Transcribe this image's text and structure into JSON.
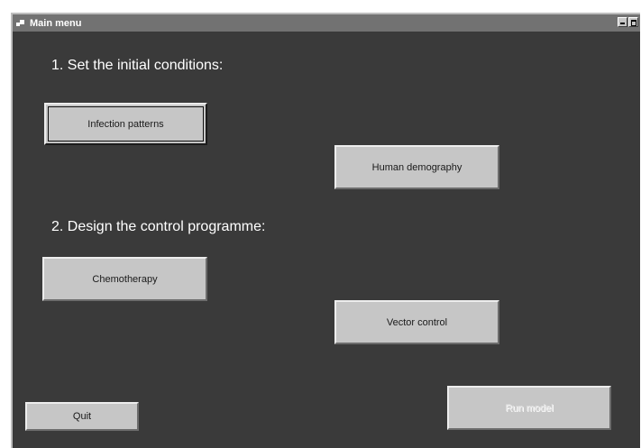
{
  "window": {
    "title": "Main menu"
  },
  "section1": {
    "heading": "1. Set the initial conditions:"
  },
  "section2": {
    "heading": "2. Design the control programme:"
  },
  "buttons": {
    "infection_patterns": "Infection patterns",
    "human_demography": "Human demography",
    "chemotherapy": "Chemotherapy",
    "vector_control": "Vector control",
    "quit": "Quit",
    "run_model": "Run model"
  },
  "colors": {
    "window_bg": "#3a3a3a",
    "titlebar": "#727272",
    "button_face": "#c6c6c6"
  },
  "icons": [
    "app-icon",
    "minimize-icon",
    "maximize-icon"
  ]
}
